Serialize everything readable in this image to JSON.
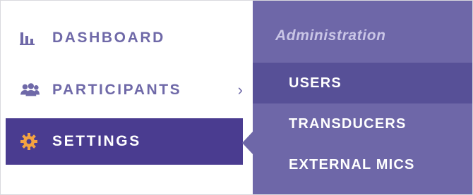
{
  "sidebar": {
    "items": [
      {
        "label": "DASHBOARD",
        "icon": "bar-chart-icon"
      },
      {
        "label": "PARTICIPANTS",
        "icon": "users-icon",
        "chevron": "›"
      },
      {
        "label": "SETTINGS",
        "icon": "gear-icon",
        "active": true
      }
    ]
  },
  "submenu": {
    "heading": "Administration",
    "items": [
      {
        "label": "USERS",
        "active": true
      },
      {
        "label": "TRANSDUCERS"
      },
      {
        "label": "EXTERNAL MICS"
      }
    ]
  },
  "colors": {
    "accent_dark": "#4a3c90",
    "nav_text": "#6f69a8",
    "submenu_bg": "#6e67a8",
    "submenu_active": "#575097",
    "gear_orange": "#f4a340"
  }
}
